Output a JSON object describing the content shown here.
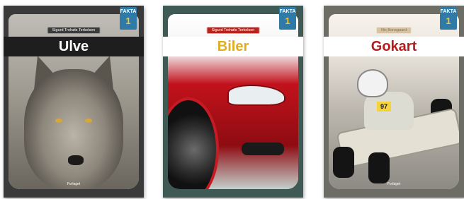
{
  "books": [
    {
      "series_badge": {
        "word": "FAKTA",
        "level": "1"
      },
      "author": "Sigurd Trehøls Terkelsen",
      "title": "Ulve",
      "publisher": "Forlaget"
    },
    {
      "series_badge": {
        "word": "FAKTA",
        "level": "1"
      },
      "author": "Sigurd Trehøls Terkelsen",
      "title": "Biler",
      "publisher": ""
    },
    {
      "series_badge": {
        "word": "FAKTA",
        "level": "1"
      },
      "author": "Nic Bonsgaard",
      "title": "Gokart",
      "publisher": "Forlaget",
      "kart_number": "97"
    }
  ],
  "colors": {
    "ulve_title": "#ffffff",
    "biler_title": "#e0ad1d",
    "gokart_title": "#b21c1c",
    "badge": "#2f7aa7",
    "badge_level": "#f6c331"
  }
}
